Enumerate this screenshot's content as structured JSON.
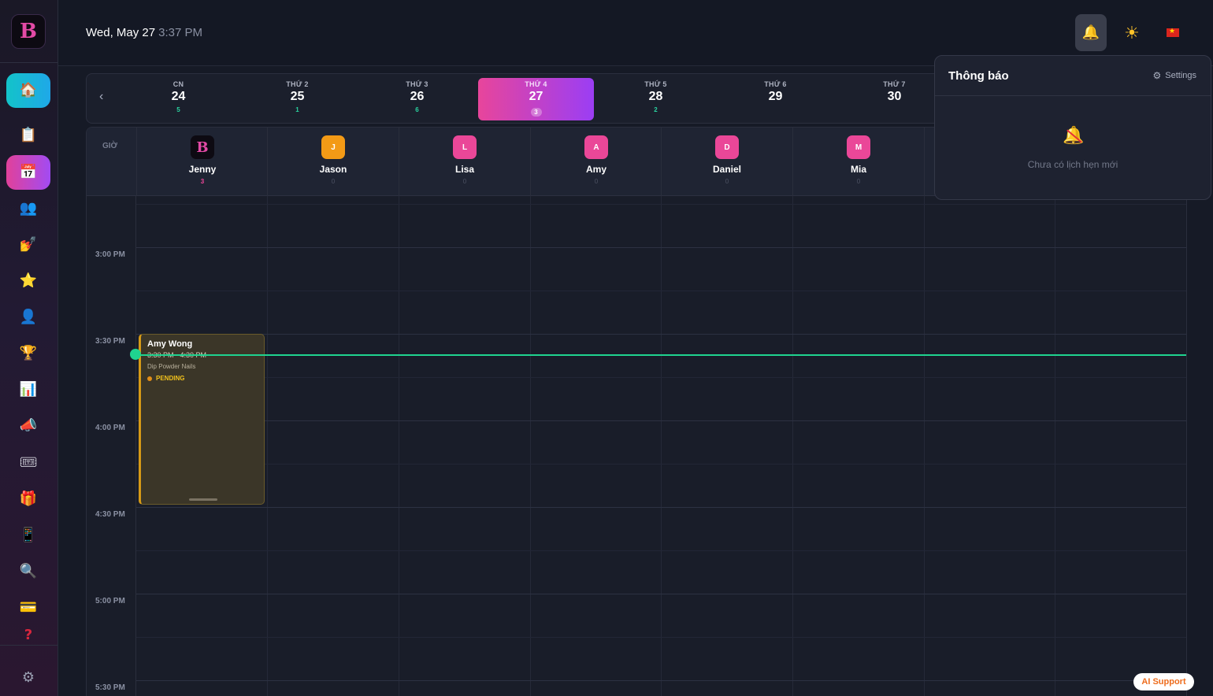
{
  "brand": {
    "logo_letter": "B"
  },
  "sidebar": {
    "items": [
      {
        "name": "home",
        "icon": "🏠"
      },
      {
        "name": "clipboard",
        "icon": "📋"
      },
      {
        "name": "calendar",
        "icon": "📅"
      },
      {
        "name": "users",
        "icon": "👥"
      },
      {
        "name": "nail-polish",
        "icon": "💅"
      },
      {
        "name": "star",
        "icon": "⭐"
      },
      {
        "name": "user",
        "icon": "👤"
      },
      {
        "name": "trophy",
        "icon": "🏆"
      },
      {
        "name": "chart",
        "icon": "📊"
      },
      {
        "name": "megaphone",
        "icon": "📣"
      },
      {
        "name": "ticket",
        "icon": "🎟"
      },
      {
        "name": "gift",
        "icon": "🎁"
      },
      {
        "name": "phone",
        "icon": "📱"
      },
      {
        "name": "search",
        "icon": "🔍"
      },
      {
        "name": "card",
        "icon": "💳"
      },
      {
        "name": "help",
        "icon": "?"
      }
    ],
    "settings_icon": "⚙"
  },
  "header": {
    "date": "Wed, May 27",
    "time": "3:37 PM",
    "bell_icon": "🔔",
    "sun_icon": "☀"
  },
  "week": {
    "prev_icon": "‹",
    "days": [
      {
        "name": "CN",
        "num": "24",
        "count": "5"
      },
      {
        "name": "THỨ 2",
        "num": "25",
        "count": "1"
      },
      {
        "name": "THỨ 3",
        "num": "26",
        "count": "6"
      },
      {
        "name": "THỨ 4",
        "num": "27",
        "count": "3"
      },
      {
        "name": "THỨ 5",
        "num": "28",
        "count": "2"
      },
      {
        "name": "THỨ 6",
        "num": "29",
        "count": ""
      },
      {
        "name": "THỨ 7",
        "num": "30",
        "count": ""
      }
    ]
  },
  "calendar": {
    "gio_label": "GIỜ",
    "staff": [
      {
        "initial": "B",
        "name": "Jenny",
        "count": "3",
        "color": "#0d0a12"
      },
      {
        "initial": "J",
        "name": "Jason",
        "count": "0",
        "color": "#f39a16"
      },
      {
        "initial": "L",
        "name": "Lisa",
        "count": "0",
        "color": "#ea4798"
      },
      {
        "initial": "A",
        "name": "Amy",
        "count": "0",
        "color": "#ea4798"
      },
      {
        "initial": "D",
        "name": "Daniel",
        "count": "0",
        "color": "#ea4798"
      },
      {
        "initial": "M",
        "name": "Mia",
        "count": "0",
        "color": "#ea4798"
      }
    ],
    "times": [
      "3:00 PM",
      "3:30 PM",
      "4:00 PM",
      "4:30 PM",
      "5:00 PM",
      "5:30 PM"
    ],
    "appointment": {
      "client": "Amy Wong",
      "time": "3:30 PM - 4:30 PM",
      "service": "Dip Powder Nails",
      "status": "PENDING"
    }
  },
  "notifications": {
    "title": "Thông báo",
    "settings_label": "Settings",
    "empty_text": "Chưa có lịch hẹn mới"
  },
  "ai_support_label": "AI Support"
}
